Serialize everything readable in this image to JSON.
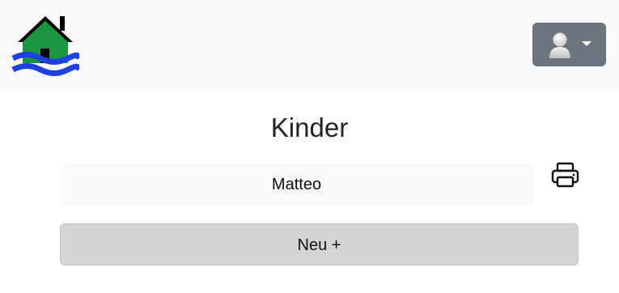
{
  "page": {
    "title": "Kinder"
  },
  "navbar": {
    "logo_icon": "house-flood-icon",
    "user_menu_icon": "user-avatar-icon",
    "caret_icon": "caret-down-icon"
  },
  "children": [
    {
      "name": "Matteo"
    }
  ],
  "actions": {
    "print_icon": "printer-icon",
    "new_label": "Neu +"
  },
  "colors": {
    "navbar_bg": "#f8f9fa",
    "user_menu_bg": "#6c757d",
    "house_roof": "#000000",
    "house_body": "#1a9641",
    "water": "#1f3fe0",
    "item_bg": "#f8f9fa",
    "new_button_bg": "#d3d4d5"
  }
}
